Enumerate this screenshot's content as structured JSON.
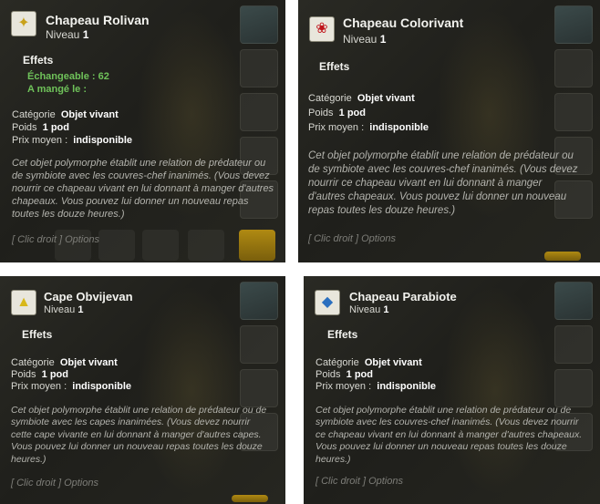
{
  "panels": [
    {
      "icon": "golden-stick-icon",
      "name": "Chapeau Rolivan",
      "level_label": "Niveau",
      "level": "1",
      "effects_label": "Effets",
      "extra_effects": [
        "Échangeable : 62",
        "A mangé le :"
      ],
      "category_label": "Catégorie",
      "category": "Objet vivant",
      "weight_label": "Poids",
      "weight": "1 pod",
      "price_label": "Prix moyen :",
      "price": "indisponible",
      "description": "Cet objet polymorphe établit une relation de prédateur ou de symbiote avec les couvres-chef inanimés. (Vous devez nourrir ce chapeau vivant en lui donnant à manger d'autres chapeaux. Vous pouvez lui donner un nouveau repas toutes les douze heures.)",
      "options": "[ Clic droit ] Options"
    },
    {
      "icon": "red-bow-icon",
      "name": "Chapeau Colorivant",
      "level_label": "Niveau",
      "level": "1",
      "effects_label": "Effets",
      "extra_effects": [],
      "category_label": "Catégorie",
      "category": "Objet vivant",
      "weight_label": "Poids",
      "weight": "1 pod",
      "price_label": "Prix moyen :",
      "price": "indisponible",
      "description": "Cet objet polymorphe établit une relation de prédateur ou de symbiote avec les couvres-chef inanimés. (Vous devez nourrir ce chapeau vivant en lui donnant à manger d'autres chapeaux. Vous pouvez lui donner un nouveau repas toutes les douze heures.)",
      "options": "[ Clic droit ] Options"
    },
    {
      "icon": "yellow-cape-icon",
      "name": "Cape Obvijevan",
      "level_label": "Niveau",
      "level": "1",
      "effects_label": "Effets",
      "extra_effects": [],
      "category_label": "Catégorie",
      "category": "Objet vivant",
      "weight_label": "Poids",
      "weight": "1 pod",
      "price_label": "Prix moyen :",
      "price": "indisponible",
      "description": "Cet objet polymorphe établit une relation de prédateur ou de symbiote avec les capes inanimées. (Vous devez nourrir cette cape vivante en lui donnant à manger d'autres capes. Vous pouvez lui donner un nouveau repas toutes les douze heures.)",
      "options": "[ Clic droit ] Options"
    },
    {
      "icon": "blue-rabbit-icon",
      "name": "Chapeau Parabiote",
      "level_label": "Niveau",
      "level": "1",
      "effects_label": "Effets",
      "extra_effects": [],
      "category_label": "Catégorie",
      "category": "Objet vivant",
      "weight_label": "Poids",
      "weight": "1 pod",
      "price_label": "Prix moyen :",
      "price": "indisponible",
      "description": "Cet objet polymorphe établit une relation de prédateur ou de symbiote avec les couvres-chef inanimés. (Vous devez nourrir ce chapeau vivant en lui donnant à manger d'autres chapeaux. Vous pouvez lui donner un nouveau repas toutes les douze heures.)",
      "options": "[ Clic droit ] Options"
    }
  ]
}
